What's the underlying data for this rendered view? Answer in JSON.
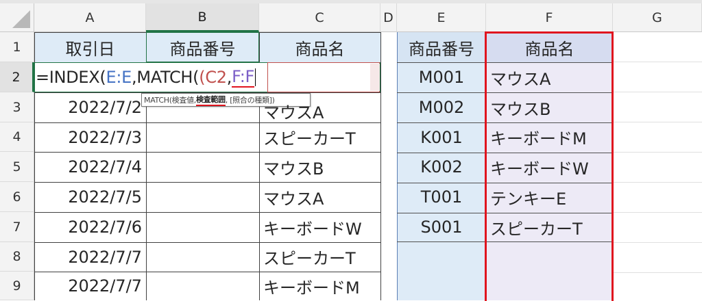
{
  "columns": [
    "A",
    "B",
    "C",
    "D",
    "E",
    "F",
    "G"
  ],
  "rows": [
    "1",
    "2",
    "3",
    "4",
    "5",
    "6",
    "7",
    "8",
    "9"
  ],
  "headers": {
    "A1": "取引日",
    "B1": "商品番号",
    "C1": "商品名",
    "E1": "商品番号",
    "F1": "商品名"
  },
  "formula": {
    "eq": "=INDEX(",
    "ref1": "E:E",
    ",match": ",MATCH(",
    "paren": "(",
    "ref2": "C2",
    ",": ",",
    "ref3": "F:F"
  },
  "tooltip": {
    "text_pre": "MATCH(検査値, ",
    "text_bold": "検査範囲",
    ",text_post": ", [照合の種類])"
  },
  "col_a": [
    "2022/7/2",
    "2022/7/3",
    "2022/7/4",
    "2022/7/5",
    "2022/7/6",
    "2022/7/7",
    "2022/7/7"
  ],
  "col_c": [
    "マウスA",
    "スピーカーT",
    "マウスB",
    "マウスA",
    "キーボードW",
    "スピーカーT",
    "キーボードM"
  ],
  "col_e": [
    "M001",
    "M002",
    "K001",
    "K002",
    "T001",
    "S001"
  ],
  "col_f": [
    "マウスA",
    "マウスB",
    "キーボードM",
    "キーボードW",
    "テンキーE",
    "スピーカーT"
  ],
  "colors": {
    "ref_blue": "#4472c4",
    "ref_red": "#c0504d",
    "ref_purple": "#7c5fc7",
    "highlight_red": "#e0141e",
    "excel_green": "#217346"
  }
}
